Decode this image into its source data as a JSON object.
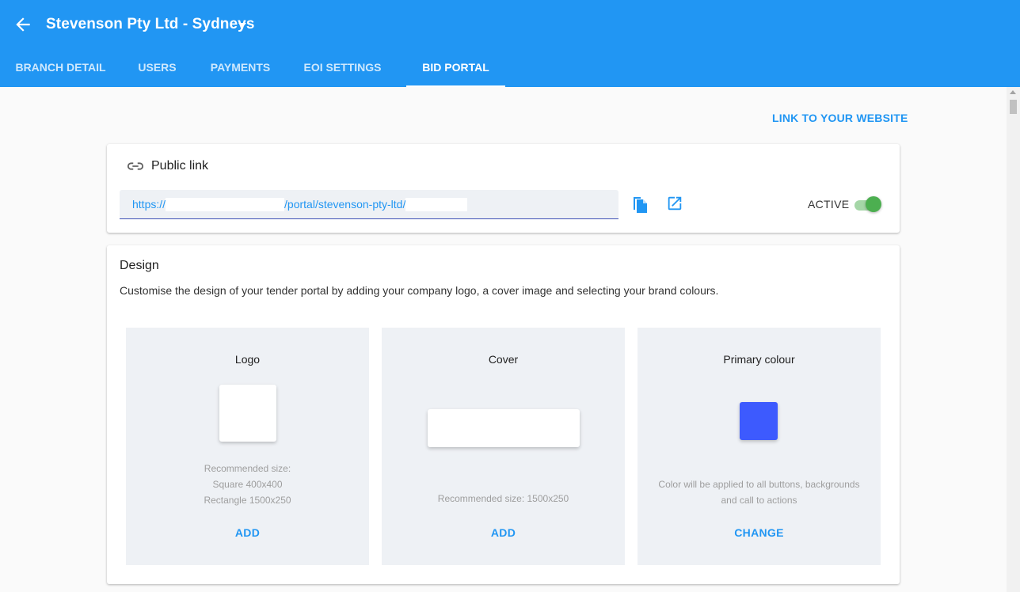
{
  "header": {
    "title": "Stevenson Pty Ltd - Sydneys",
    "back_icon": "arrow-left-icon",
    "caret_icon": "caret-down-icon"
  },
  "tabs": [
    {
      "label": "BRANCH DETAIL",
      "active": false
    },
    {
      "label": "USERS",
      "active": false
    },
    {
      "label": "PAYMENTS",
      "active": false
    },
    {
      "label": "EOI SETTINGS",
      "active": false
    },
    {
      "label": "BID PORTAL",
      "active": true
    }
  ],
  "link_website": "LINK TO YOUR WEBSITE",
  "public_link": {
    "title": "Public link",
    "icon": "link-icon",
    "url_prefix": "https://",
    "url_mid": "/portal/stevenson-pty-ltd/",
    "copy_icon": "copy-icon",
    "open_icon": "open-in-new-icon",
    "status_label": "ACTIVE",
    "active": true
  },
  "design": {
    "title": "Design",
    "description": "Customise the design of your tender portal by adding your company logo, a cover image and selecting your brand colours.",
    "logo": {
      "title": "Logo",
      "hint_lines": [
        "Recommended size:",
        "Square 400x400",
        "Rectangle 1500x250"
      ],
      "action": "ADD"
    },
    "cover": {
      "title": "Cover",
      "hint_lines": [
        "Recommended size: 1500x250"
      ],
      "action": "ADD"
    },
    "primary_colour": {
      "title": "Primary colour",
      "hint_lines": [
        "Color will be applied to all buttons, backgrounds",
        "and call to actions"
      ],
      "action": "CHANGE",
      "color": "#3d5afe"
    }
  },
  "colors": {
    "appbar": "#2196f3",
    "accent": "#2196f3",
    "toggle_on": "#4caf50"
  }
}
